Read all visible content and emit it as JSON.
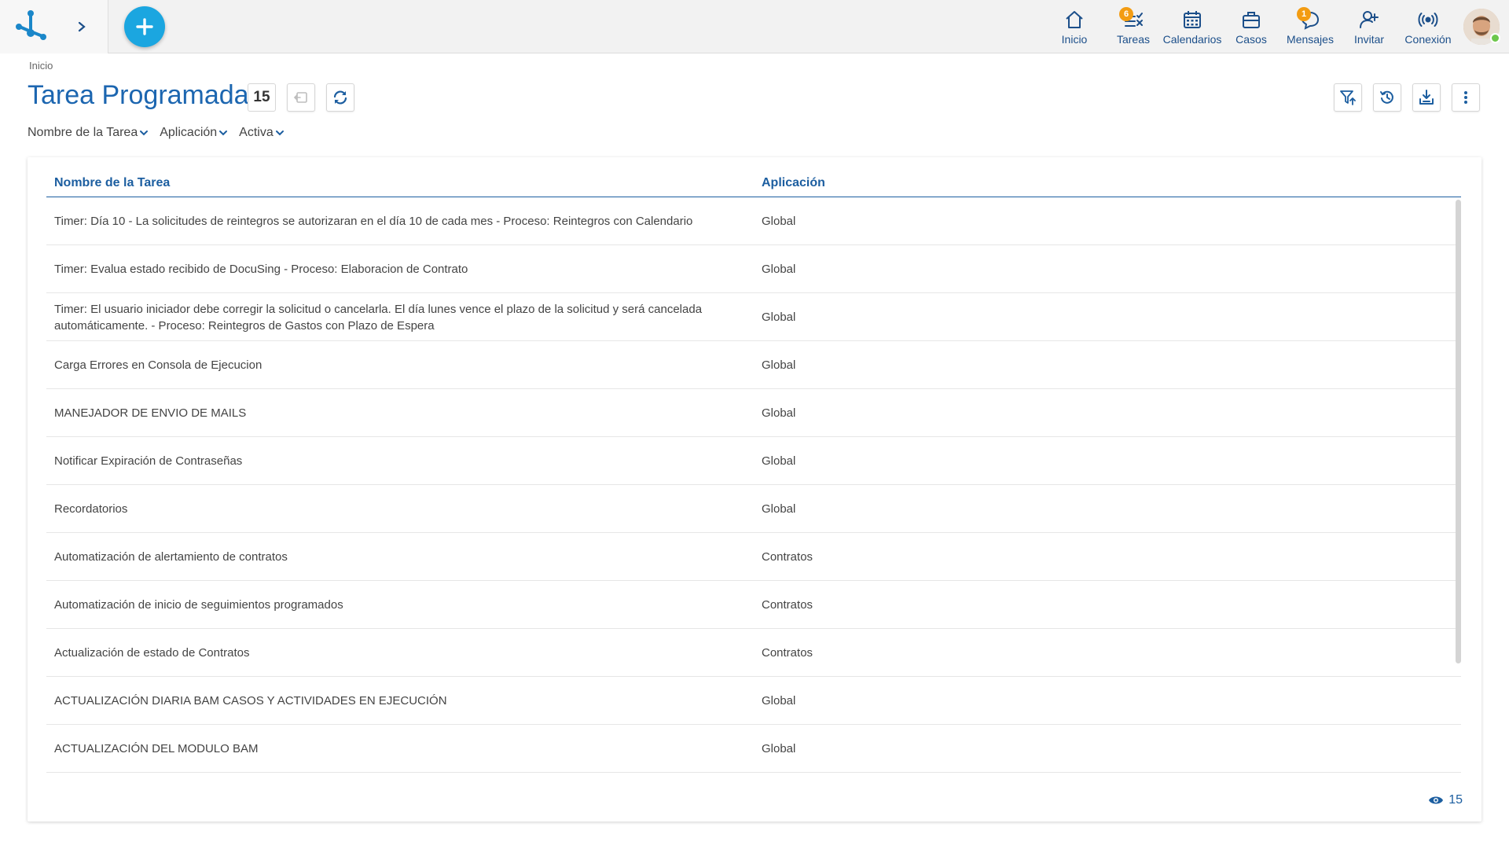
{
  "topbar": {
    "nav": [
      {
        "id": "inicio",
        "label": "Inicio",
        "icon": "home-icon",
        "badge": null
      },
      {
        "id": "tareas",
        "label": "Tareas",
        "icon": "tasks-icon",
        "badge": "6"
      },
      {
        "id": "calendarios",
        "label": "Calendarios",
        "icon": "calendar-icon",
        "badge": null
      },
      {
        "id": "casos",
        "label": "Casos",
        "icon": "briefcase-icon",
        "badge": null
      },
      {
        "id": "mensajes",
        "label": "Mensajes",
        "icon": "chat-icon",
        "badge": "1"
      },
      {
        "id": "invitar",
        "label": "Invitar",
        "icon": "add-user-icon",
        "badge": null
      },
      {
        "id": "conexion",
        "label": "Conexión",
        "icon": "broadcast-icon",
        "badge": null
      }
    ],
    "accent": "#1ba6e0",
    "nav_color": "#1c4f8a",
    "badge_color": "#f39c12"
  },
  "header": {
    "breadcrumb": "Inicio",
    "title": "Tarea Programada",
    "count": "15"
  },
  "filters": [
    {
      "label": "Nombre de la Tarea"
    },
    {
      "label": "Aplicación"
    },
    {
      "label": "Activa"
    }
  ],
  "table": {
    "columns": [
      "Nombre de la Tarea",
      "Aplicación"
    ],
    "rows": [
      {
        "name": "Timer: Día 10 - La solicitudes de reintegros se autorizaran en el día 10 de cada mes - Proceso: Reintegros con Calendario",
        "app": "Global"
      },
      {
        "name": "Timer: Evalua estado recibido de DocuSing - Proceso: Elaboracion de Contrato",
        "app": "Global"
      },
      {
        "name": "Timer: El usuario iniciador debe corregir la solicitud o cancelarla. El día lunes vence el plazo de la solicitud y será cancelada automáticamente. - Proceso: Reintegros de Gastos con Plazo de Espera",
        "app": "Global"
      },
      {
        "name": "Carga Errores en Consola de Ejecucion",
        "app": "Global"
      },
      {
        "name": "MANEJADOR DE ENVIO DE MAILS",
        "app": "Global"
      },
      {
        "name": "Notificar Expiración de Contraseñas",
        "app": "Global"
      },
      {
        "name": "Recordatorios",
        "app": "Global"
      },
      {
        "name": "Automatización de alertamiento de contratos",
        "app": "Contratos"
      },
      {
        "name": "Automatización de inicio de seguimientos programados",
        "app": "Contratos"
      },
      {
        "name": "Actualización de estado de Contratos",
        "app": "Contratos"
      },
      {
        "name": "ACTUALIZACIÓN DIARIA BAM CASOS Y ACTIVIDADES EN EJECUCIÓN",
        "app": "Global"
      },
      {
        "name": "ACTUALIZACIÓN DEL MODULO BAM",
        "app": "Global"
      }
    ]
  },
  "footer": {
    "visible_count": "15"
  }
}
